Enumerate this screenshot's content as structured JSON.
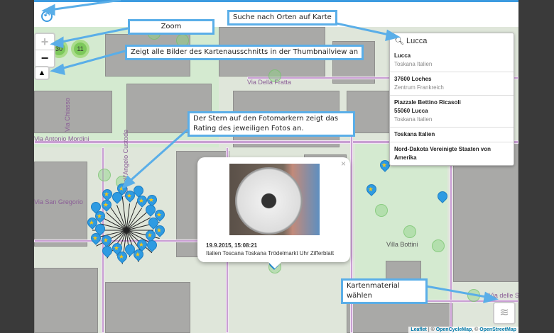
{
  "header": {
    "back_icon": "undo-icon"
  },
  "controls": {
    "zoom_in": "+",
    "zoom_out": "−",
    "thumbnail_icon": "image-icon",
    "layers_icon": "layers-icon"
  },
  "clusters": [
    {
      "count": "30"
    },
    {
      "count": "11"
    }
  ],
  "search": {
    "value": "Lucca",
    "icon": "search-icon",
    "results": [
      {
        "title": "Lucca",
        "sub": "Toskana Italien"
      },
      {
        "title": "37600 Loches",
        "sub": "Zentrum Frankreich"
      },
      {
        "title": "Piazzale Bettino Ricasoli",
        "title2": "55060 Lucca",
        "sub": "Toskana Italien"
      },
      {
        "title": "Toskana Italien"
      },
      {
        "title": "Nord-Dakota Vereinigte Staaten von Amerika"
      }
    ]
  },
  "streets": [
    "Via Della Fratta",
    "Via Antonio Mordini",
    "Via San Gregorio",
    "Villa Bottini",
    "Via delle Sette",
    "Via Chiasso",
    "Via dell'Angelo Custode"
  ],
  "popup": {
    "close": "×",
    "date": "19.9.2015, 15:08:21",
    "tags": "Italien Toscana Toskana Trödelmarkt Uhr Zifferblatt"
  },
  "attribution": {
    "leaflet": "Leaflet",
    "sep1": " | © ",
    "ocm": "OpenCycleMap",
    "sep2": ", © ",
    "osm": "OpenStreetMap"
  },
  "callouts": {
    "search": "Suche nach Orten auf Karte",
    "zoom": "Zoom",
    "thumbnail": "Zeigt alle Bilder des Kartenausschnitts in der Thumbnailview an",
    "star": "Der Stern auf den Fotomarkern zeigt das Rating des jeweiligen Fotos an.",
    "layers": "Kartenmaterial wählen"
  },
  "colors": {
    "accent": "#3c9be0",
    "marker": "#2e9be2",
    "star": "#f5c518"
  }
}
